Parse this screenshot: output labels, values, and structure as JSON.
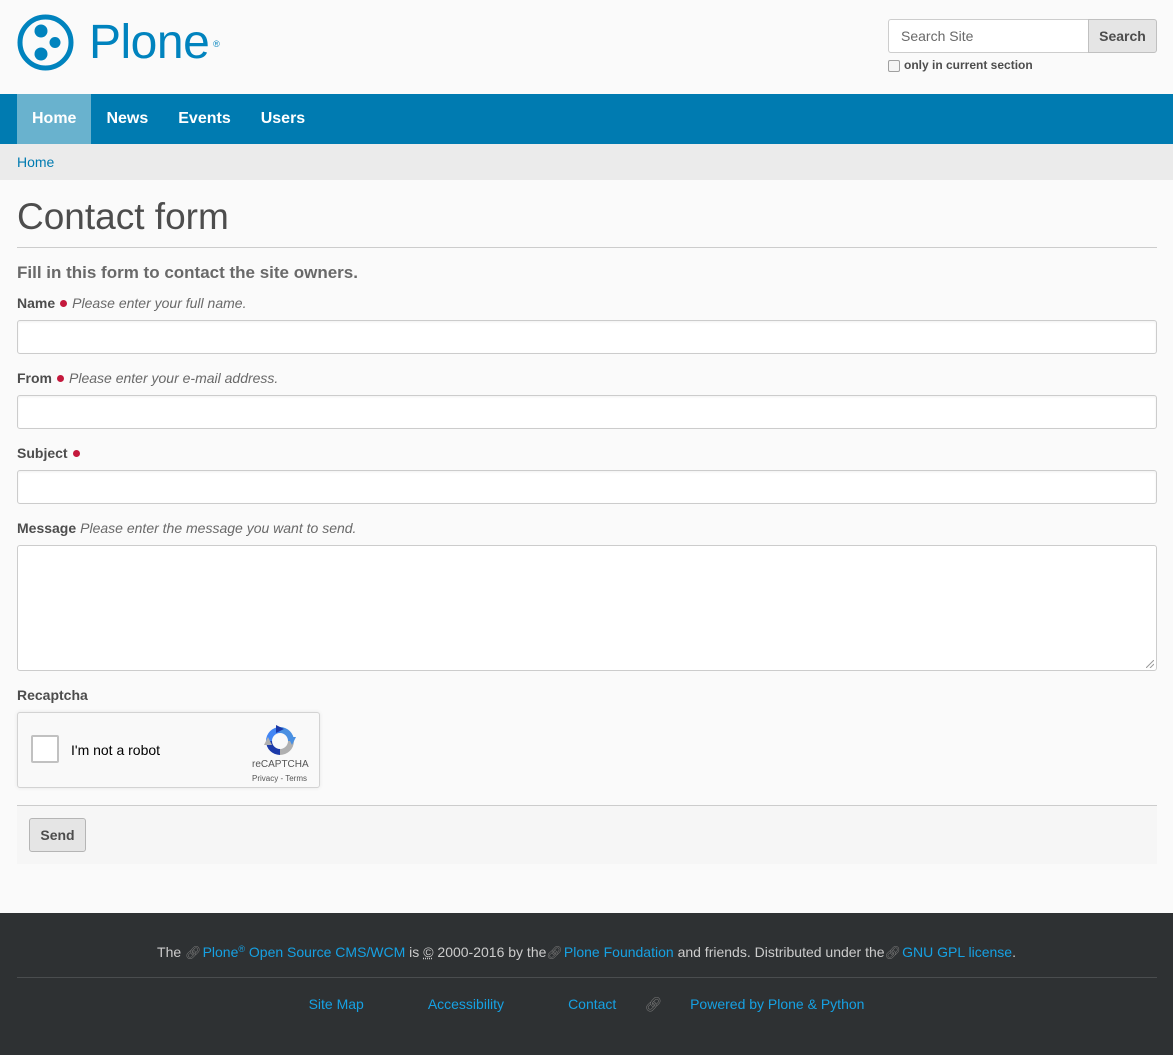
{
  "brand": {
    "name": "Plone",
    "reg": "®",
    "color": "#0083be"
  },
  "search": {
    "placeholder": "Search Site",
    "button_label": "Search",
    "option_label": "only in current section"
  },
  "nav": {
    "items": [
      {
        "label": "Home",
        "active": true
      },
      {
        "label": "News",
        "active": false
      },
      {
        "label": "Events",
        "active": false
      },
      {
        "label": "Users",
        "active": false
      }
    ],
    "color": "#007bb1"
  },
  "breadcrumb": {
    "home": "Home"
  },
  "page": {
    "title": "Contact form",
    "description": "Fill in this form to contact the site owners."
  },
  "form": {
    "name": {
      "label": "Name",
      "help": "Please enter your full name.",
      "value": ""
    },
    "from": {
      "label": "From",
      "help": "Please enter your e-mail address.",
      "value": ""
    },
    "subject": {
      "label": "Subject",
      "value": ""
    },
    "message": {
      "label": "Message",
      "help": "Please enter the message you want to send.",
      "value": ""
    },
    "recaptcha": {
      "label": "Recaptcha",
      "checkbox_text": "I'm not a robot",
      "brand": "reCAPTCHA",
      "privacy": "Privacy",
      "separator": " - ",
      "terms": "Terms"
    },
    "send_label": "Send"
  },
  "footer": {
    "the": "The",
    "plone": "Plone",
    "reg": "®",
    "cms": "Open Source CMS/WCM",
    "is": "is",
    "copyright_symbol": "©",
    "years_by": "2000-2016 by the",
    "foundation": "Plone Foundation",
    "friends": "and friends. Distributed under the",
    "license": "GNU GPL license",
    "period": ".",
    "links": {
      "site_map": "Site Map",
      "accessibility": "Accessibility",
      "contact": "Contact",
      "powered": "Powered by Plone & Python"
    }
  }
}
